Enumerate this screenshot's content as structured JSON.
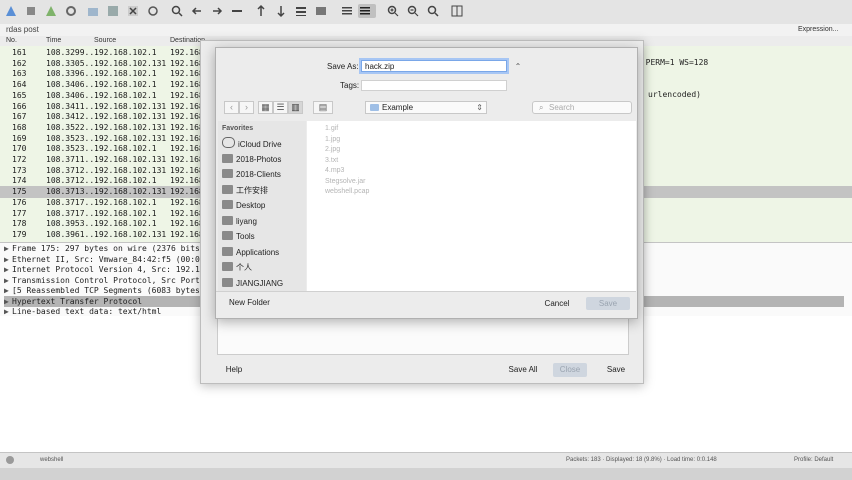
{
  "filter": {
    "text": "rdas post",
    "expression_label": "Expression..."
  },
  "packet_list": {
    "columns": [
      "No.",
      "Time",
      "Source",
      "Destination"
    ],
    "rows": [
      {
        "no": "161",
        "time": "108.3299...",
        "src": "192.168.102.1",
        "dst": "192.168.10"
      },
      {
        "no": "162",
        "time": "108.3305...",
        "src": "192.168.102.131",
        "dst": "192.168.10"
      },
      {
        "no": "163",
        "time": "108.3396...",
        "src": "192.168.102.1",
        "dst": "192.168.10"
      },
      {
        "no": "164",
        "time": "108.3406...",
        "src": "192.168.102.1",
        "dst": "192.168.10"
      },
      {
        "no": "165",
        "time": "108.3406...",
        "src": "192.168.102.1",
        "dst": "192.168.10"
      },
      {
        "no": "166",
        "time": "108.3411...",
        "src": "192.168.102.131",
        "dst": "192.168.10"
      },
      {
        "no": "167",
        "time": "108.3412...",
        "src": "192.168.102.131",
        "dst": "192.168.10"
      },
      {
        "no": "168",
        "time": "108.3522...",
        "src": "192.168.102.131",
        "dst": "192.168.10"
      },
      {
        "no": "169",
        "time": "108.3523...",
        "src": "192.168.102.131",
        "dst": "192.168.10"
      },
      {
        "no": "170",
        "time": "108.3523...",
        "src": "192.168.102.1",
        "dst": "192.168.10"
      },
      {
        "no": "172",
        "time": "108.3711...",
        "src": "192.168.102.131",
        "dst": "192.168.10"
      },
      {
        "no": "173",
        "time": "108.3712...",
        "src": "192.168.102.131",
        "dst": "192.168.10"
      },
      {
        "no": "174",
        "time": "108.3712...",
        "src": "192.168.102.1",
        "dst": "192.168.10"
      },
      {
        "no": "175",
        "time": "108.3713...",
        "src": "192.168.102.131",
        "dst": "192.168.10",
        "selected": true
      },
      {
        "no": "176",
        "time": "108.3717...",
        "src": "192.168.102.1",
        "dst": "192.168.10"
      },
      {
        "no": "177",
        "time": "108.3717...",
        "src": "192.168.102.1",
        "dst": "192.168.10"
      },
      {
        "no": "178",
        "time": "108.3953...",
        "src": "192.168.102.1",
        "dst": "192.168.10"
      },
      {
        "no": "179",
        "time": "108.3961...",
        "src": "192.168.102.131",
        "dst": "192.168.10"
      }
    ],
    "info_right_1": "K PERM=1 WS=128",
    "info_right_2": "urlencoded)"
  },
  "details": [
    {
      "text": "Frame 175: 297 bytes on wire (2376 bits),"
    },
    {
      "text": "Ethernet II, Src: Vmware_84:42:f5 (00:0c:"
    },
    {
      "text": "Internet Protocol Version 4, Src: 192.168"
    },
    {
      "text": "Transmission Control Protocol, Src Port:"
    },
    {
      "text": "[5 Reassembled TCP Segments (6083 bytes):"
    },
    {
      "text": "Hypertext Transfer Protocol",
      "selected": true
    },
    {
      "text": "Line-based text data: text/html"
    }
  ],
  "status": {
    "left": "webshell",
    "packets": "Packets: 183 · Displayed: 18 (9.8%) · Load time: 0:0.148",
    "profile": "Profile: Default"
  },
  "outer_dialog": {
    "help": "Help",
    "save_all": "Save All",
    "close": "Close",
    "save": "Save"
  },
  "save_sheet": {
    "save_as_label": "Save As:",
    "filename": "hack.zip",
    "tags_label": "Tags:",
    "location": "Example",
    "search_placeholder": "Search",
    "favorites_heading": "Favorites",
    "sidebar": [
      "iCloud Drive",
      "2018-Photos",
      "2018-Clients",
      "工作安排",
      "Desktop",
      "liyang",
      "Tools",
      "Applications",
      "个人",
      "JIANGJIANG"
    ],
    "files": [
      "1.gif",
      "1.jpg",
      "2.jpg",
      "3.txt",
      "4.mp3",
      "Stegsolve.jar",
      "webshell.pcap"
    ],
    "new_folder": "New Folder",
    "cancel": "Cancel",
    "save": "Save"
  }
}
